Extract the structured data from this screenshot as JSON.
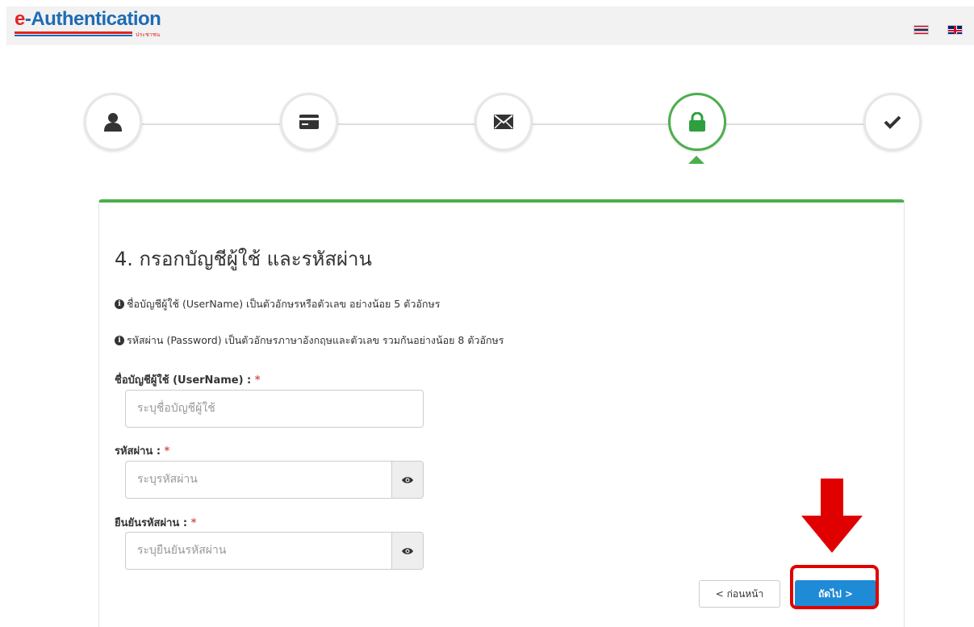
{
  "header": {
    "logo_e": "e",
    "logo_rest": "-Authentication",
    "logo_sub": "ประชาชน",
    "lang_th_icon": "thai-flag-icon",
    "lang_en_icon": "uk-flag-icon"
  },
  "steps": [
    {
      "icon": "user-icon",
      "state": "done"
    },
    {
      "icon": "id-card-icon",
      "state": "done"
    },
    {
      "icon": "envelope-icon",
      "state": "done"
    },
    {
      "icon": "lock-icon",
      "state": "active"
    },
    {
      "icon": "check-icon",
      "state": "pending"
    }
  ],
  "form": {
    "title": "4. กรอกบัญชีผู้ใช้ และรหัสผ่าน",
    "info_username": "ชื่อบัญชีผู้ใช้ (UserName) เป็นตัวอักษรหรือตัวเลข อย่างน้อย 5 ตัวอักษร",
    "info_password": "รหัสผ่าน (Password) เป็นตัวอักษรภาษาอังกฤษและตัวเลข รวมกันอย่างน้อย 8 ตัวอักษร",
    "username_label": "ชื่อบัญชีผู้ใช้ (UserName) :",
    "username_placeholder": "ระบุชื่อบัญชีผู้ใช้",
    "password_label": "รหัสผ่าน :",
    "password_placeholder": "ระบุรหัสผ่าน",
    "confirm_label": "ยืนยันรหัสผ่าน :",
    "confirm_placeholder": "ระบุยืนยันรหัสผ่าน",
    "required_mark": "*",
    "prev_label": "< ก่อนหน้า",
    "next_label": "ถัดไป >"
  },
  "colors": {
    "accent_green": "#4cae4c",
    "primary_blue": "#1f8ad6",
    "annotation_red": "#e00000"
  }
}
